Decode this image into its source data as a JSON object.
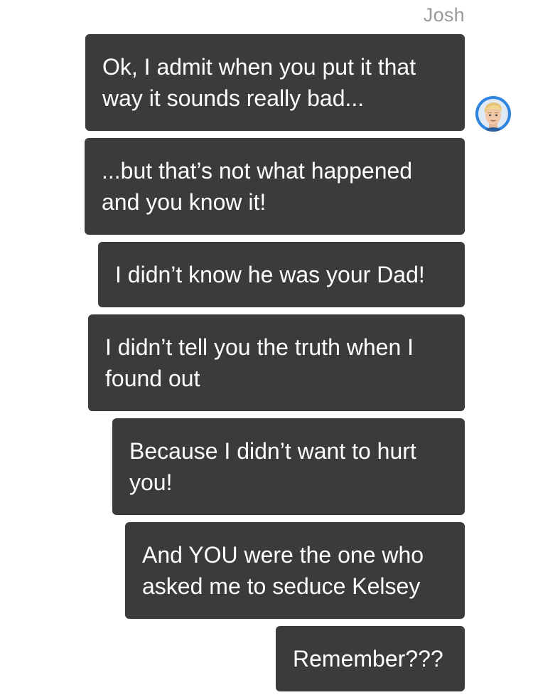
{
  "conversation": {
    "sender_name": "Josh",
    "avatar_icon": "cartoon-blond-boy-avatar",
    "messages": [
      {
        "text": "Ok, I admit when you put it that\nway it sounds really bad..."
      },
      {
        "text": "...but that’s not what happened\nand you know it!"
      },
      {
        "text": "I didn’t know he was your Dad!"
      },
      {
        "text": "I didn’t tell you the truth when I\nfound out"
      },
      {
        "text": "Because I didn’t want to hurt\nyou!"
      },
      {
        "text": "And YOU were the one who\nasked me to seduce Kelsey"
      },
      {
        "text": "Remember???"
      }
    ]
  },
  "colors": {
    "bubble_background": "#3b3b3c",
    "bubble_text": "#ffffff",
    "sender_name": "#9a9a9a",
    "avatar_ring": "#2f86e0"
  }
}
